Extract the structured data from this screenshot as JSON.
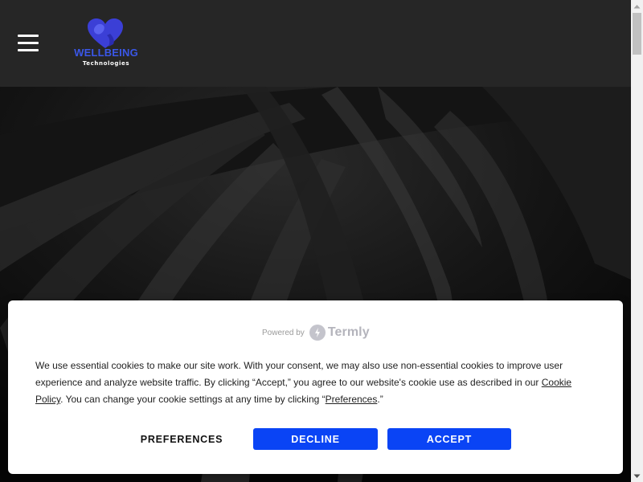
{
  "header": {
    "menu_icon": "hamburger-menu-icon",
    "logo": {
      "word": "WELLBEING",
      "sub": "Technologies",
      "icon": "heart-logo-icon"
    }
  },
  "cookie_banner": {
    "powered_by": "Powered by",
    "brand": "Termly",
    "brand_icon": "termly-logo-icon",
    "text_part1": "We use essential cookies to make our site work. With your consent, we may also use non-essential cookies to improve user experience and analyze website traffic. By clicking “Accept,” you agree to our website's cookie use as described in our ",
    "cookie_policy_link": "Cookie Policy",
    "text_part2": ". You can change your cookie settings at any time by clicking “",
    "preferences_link": "Preferences",
    "text_part3": ".”",
    "buttons": {
      "preferences": "PREFERENCES",
      "decline": "DECLINE",
      "accept": "ACCEPT"
    }
  },
  "colors": {
    "brand_blue": "#3a57e8",
    "button_blue": "#0a44f5",
    "header_bg": "#262626"
  }
}
